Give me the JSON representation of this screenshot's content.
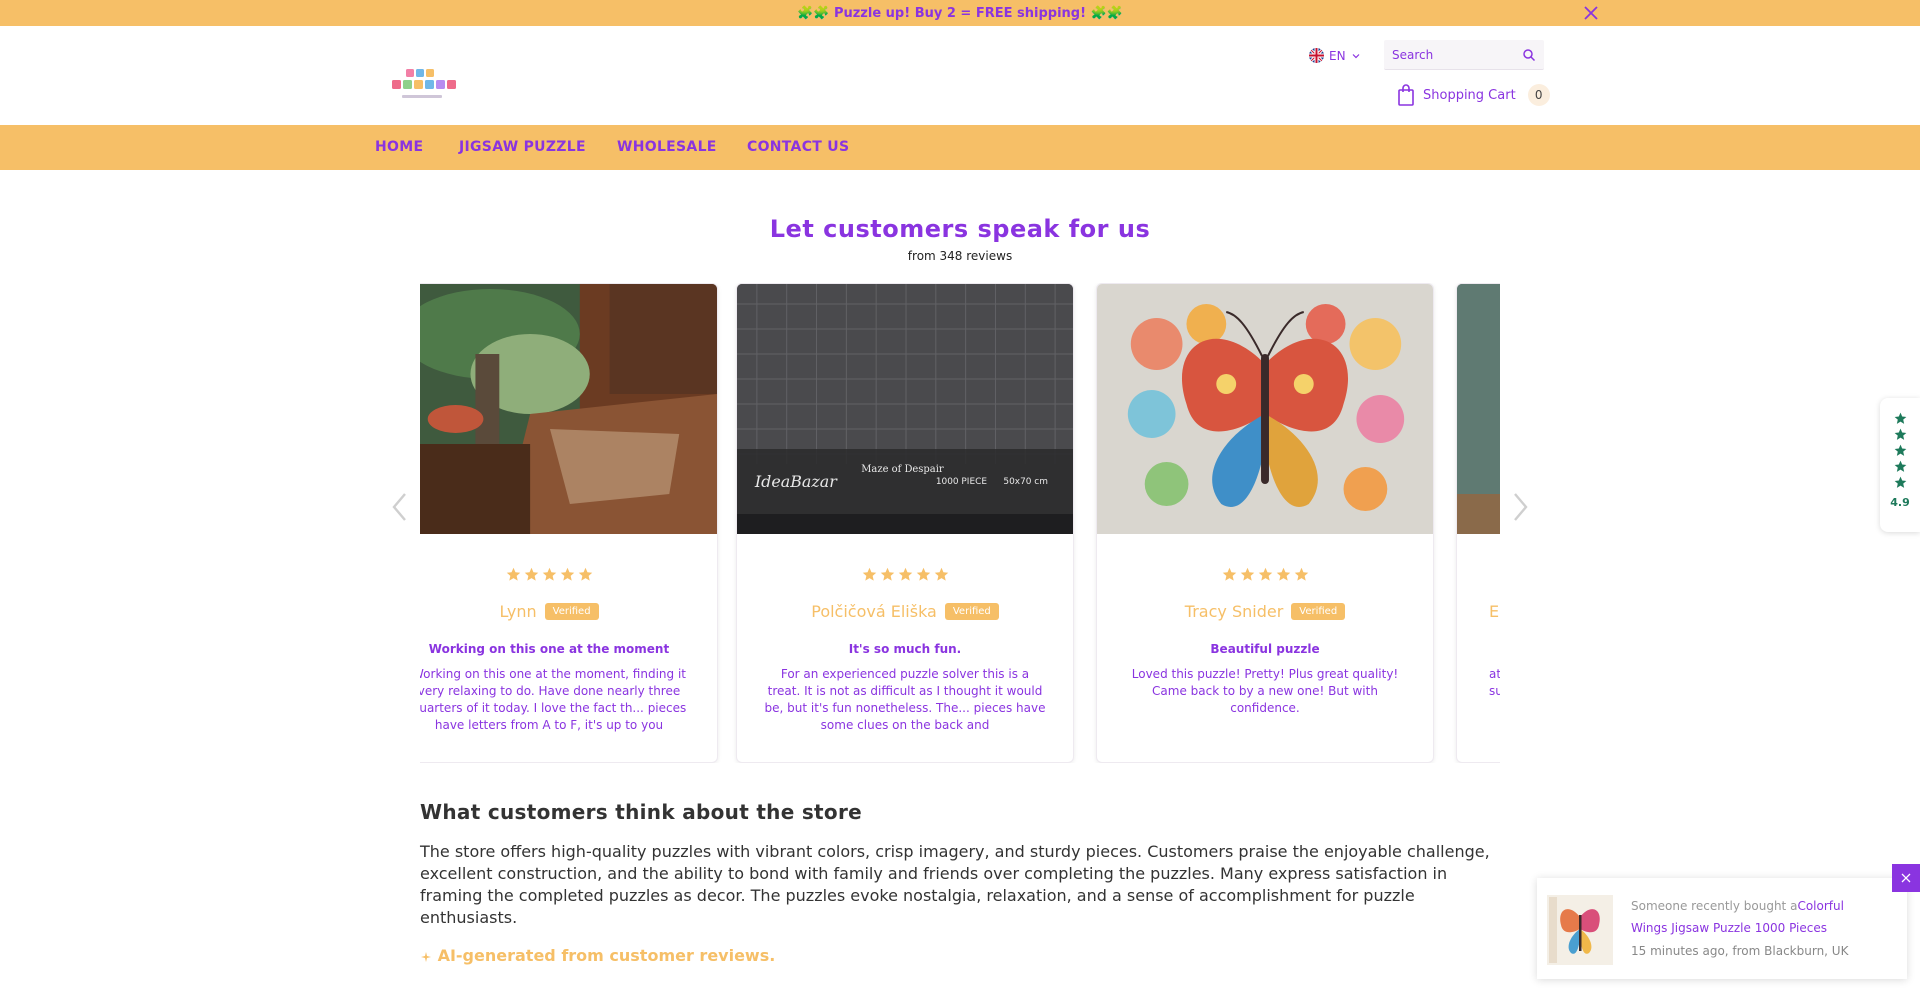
{
  "announcement": {
    "text": "🧩🧩 Puzzle up! Buy 2 = FREE shipping! 🧩🧩"
  },
  "header": {
    "logo_text": "FUN PUZZLE",
    "language": "EN",
    "search_placeholder": "Search",
    "cart_label": "Shopping Cart",
    "cart_count": "0"
  },
  "nav": {
    "items": [
      {
        "label": "HOME"
      },
      {
        "label": "JIGSAW PUZZLE"
      },
      {
        "label": "WHOLESALE"
      },
      {
        "label": "CONTACT US"
      }
    ]
  },
  "reviews": {
    "title": "Let customers speak for us",
    "subtitle": "from 348 reviews",
    "verified_label": "Verified",
    "cards": [
      {
        "name": "Lynn",
        "rating": 5,
        "title": "Working on this one at the moment",
        "body": "Working on this one at the moment, finding it very relaxing to do. Have done nearly three quarters of it today. I love the fact th... pieces have letters from A to F, it's up to you"
      },
      {
        "name": "Polčičová Eliška",
        "rating": 5,
        "title": "It's so much fun.",
        "body": "For an experienced puzzle solver this is a treat. It is not as difficult as I thought it would be, but it's fun nonetheless. The... pieces have some clues on the back and"
      },
      {
        "name": "Tracy Snider",
        "rating": 5,
        "title": "Beautiful puzzle",
        "body": "Loved this puzzle! Pretty! Plus great quality! Came back to by a new one! But with confidence."
      },
      {
        "name": "E",
        "rating": 5,
        "title": "",
        "body": "at su"
      }
    ],
    "box_brand": "IdeaBazar",
    "box_title": "Maze of Despair",
    "box_pieces": "1000 PIECE",
    "box_size": "50x70 cm"
  },
  "summary": {
    "title": "What customers think about the store",
    "text": "The store offers high-quality puzzles with vibrant colors, crisp imagery, and sturdy pieces. Customers praise the enjoyable challenge, excellent construction, and the ability to bond with family and friends over completing the puzzles. Many express satisfaction in framing the completed puzzles as decor. The puzzles evoke nostalgia, relaxation, and a sense of accomplishment for puzzle enthusiasts.",
    "ai_note": "AI-generated from customer reviews."
  },
  "rating_badge": {
    "value": "4.9",
    "stars": 5
  },
  "popup": {
    "prefix": "Someone recently bought a",
    "product": "Colorful Wings Jigsaw Puzzle 1000 Pieces",
    "meta": "15 minutes ago, from Blackburn, UK"
  },
  "colors": {
    "accent": "#8a34e0",
    "band": "#f6bf67",
    "badge_green": "#1e7a5b"
  },
  "icons": [
    "close-icon",
    "flag-uk-icon",
    "chevron-down-icon",
    "search-icon",
    "shopping-bag-icon",
    "star-icon",
    "chevron-left-icon",
    "chevron-right-icon",
    "sparkle-icon"
  ]
}
